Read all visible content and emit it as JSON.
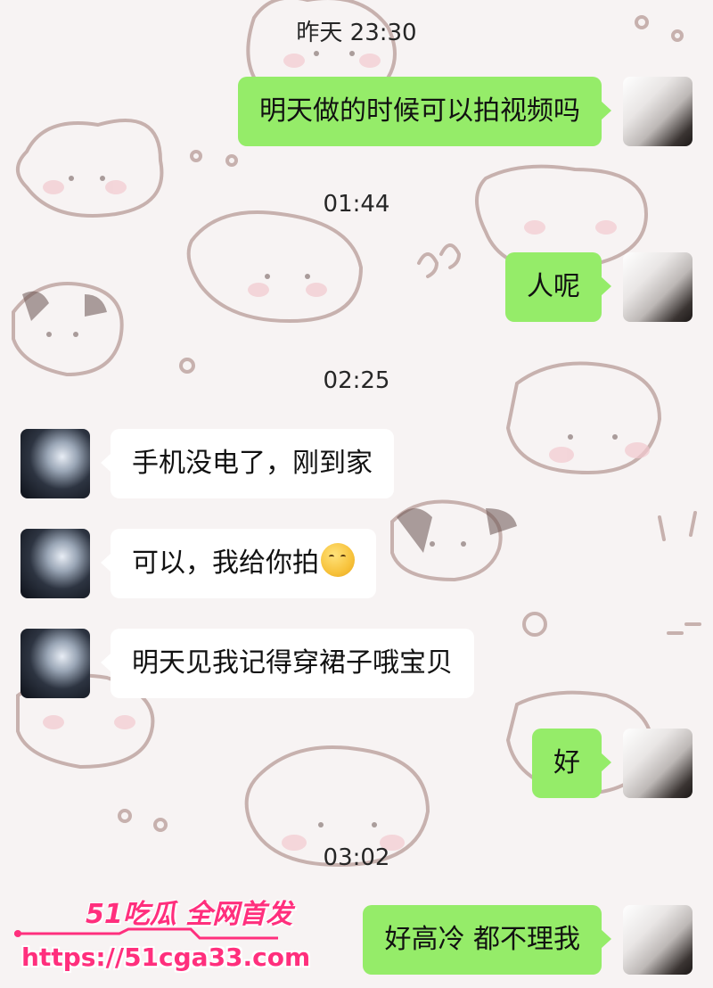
{
  "timestamps": [
    "昨天 23:30",
    "01:44",
    "02:25",
    "03:02"
  ],
  "messages": [
    {
      "sender": "self",
      "text": "明天做的时候可以拍视频吗"
    },
    {
      "sender": "self",
      "text": "人呢"
    },
    {
      "sender": "other",
      "text": "手机没电了，刚到家"
    },
    {
      "sender": "other",
      "text": "可以，我给你拍",
      "emoji": "kissing-face-emoji"
    },
    {
      "sender": "other",
      "text": "明天见我记得穿裙子哦宝贝"
    },
    {
      "sender": "self",
      "text": "好"
    },
    {
      "sender": "self",
      "text": "好高冷 都不理我"
    }
  ],
  "watermark": {
    "title": "51吃瓜 全网首发",
    "url": "https://51cga33.com"
  },
  "colors": {
    "self_bubble": "#95ec69",
    "other_bubble": "#ffffff",
    "background": "#f7f3f3",
    "watermark": "#ff2f7d"
  }
}
